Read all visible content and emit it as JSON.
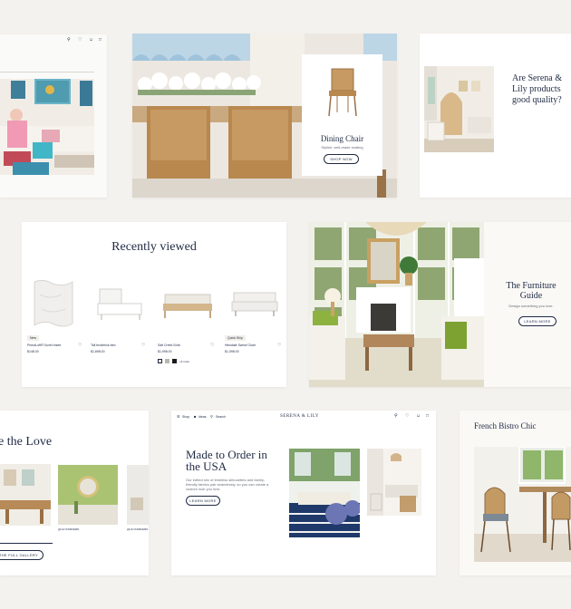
{
  "card1": {
    "nav_icons": [
      "pin-icon",
      "heart-icon",
      "user-icon",
      "bag-icon"
    ]
  },
  "card2": {
    "product_title": "Dining Chair",
    "product_subtitle": "Stylish, well-made seating",
    "cta": "SHOP NOW"
  },
  "card3": {
    "heading": "Are Serena & Lily products good quality?"
  },
  "card4": {
    "title": "Recently viewed",
    "products": [
      {
        "badge": "New",
        "name": "PrimaLoft® Duvet Insert",
        "price": "$148.00"
      },
      {
        "badge": "",
        "name": "Tall broderick bed",
        "price": "$1,698.00"
      },
      {
        "badge": "",
        "name": "Salt Creek Sofa",
        "price": "$1,998.00"
      },
      {
        "badge": "Quick Ship",
        "name": "Hinsdale Swivel Chair",
        "price": "$1,098.00"
      }
    ],
    "swatch_more": "+6 more",
    "colors": {
      "swatch1": "#e8e4dc",
      "swatch2": "#b9b6b0",
      "swatch3": "#1b1b1b"
    }
  },
  "card5": {
    "heading": "The Furniture Guide",
    "subtitle": "Design something you love.",
    "cta": "LEARN MORE"
  },
  "card6": {
    "heading": "e the Love",
    "caption1": "@LILYANDFERN",
    "caption2": "@LILYANDFERN",
    "cta": "E THE FULL GALLERY"
  },
  "card7": {
    "nav_shop": "Shop",
    "nav_ideas": "Ideas",
    "nav_search": "Search",
    "brand": "SERENA & LILY",
    "heading": "Made to Order in the USA",
    "body": "Our edited mix of timeless silhouettes and family-friendly fabrics pair seamlessly, so you can create a custom look you love.",
    "cta": "LEARN MORE"
  },
  "card8": {
    "heading": "French Bistro Chic"
  }
}
